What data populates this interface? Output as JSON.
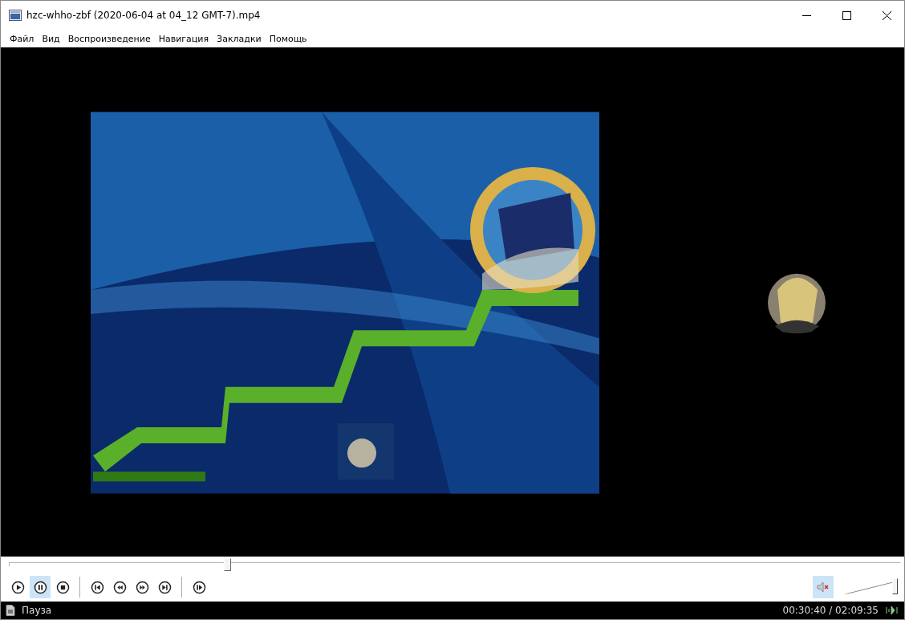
{
  "window": {
    "title": "hzc-whho-zbf (2020-06-04 at 04_12 GMT-7).mp4"
  },
  "menu": [
    {
      "label": "Файл"
    },
    {
      "label": "Вид"
    },
    {
      "label": "Воспроизведение"
    },
    {
      "label": "Навигация"
    },
    {
      "label": "Закладки"
    },
    {
      "label": "Помощь"
    }
  ],
  "seek": {
    "level": 0.245
  },
  "controls": [
    {
      "kind": "play",
      "selected": false
    },
    {
      "kind": "pause",
      "selected": true
    },
    {
      "kind": "stop",
      "selected": false
    },
    {
      "kind": "separator"
    },
    {
      "kind": "previous",
      "selected": false
    },
    {
      "kind": "rewind",
      "selected": false
    },
    {
      "kind": "forward",
      "selected": false
    },
    {
      "kind": "next",
      "selected": false
    },
    {
      "kind": "separator"
    },
    {
      "kind": "frame-step",
      "selected": false
    }
  ],
  "mute": {
    "muted": true
  },
  "volume": {
    "level": 1
  },
  "status": {
    "state": "Пауза",
    "time": "00:30:40 / 02:09:35"
  }
}
